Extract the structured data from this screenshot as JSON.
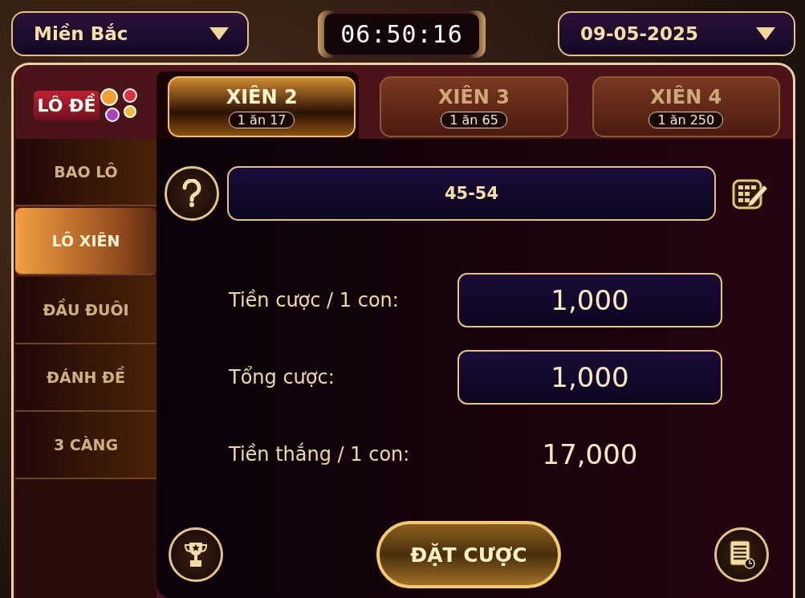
{
  "region": {
    "value": "Miền Bắc"
  },
  "clock": "06:50:16",
  "date": {
    "value": "09-05-2025"
  },
  "logo": "LÔ ĐỀ",
  "tabs": [
    {
      "label": "XIÊN 2",
      "odds": "1 ăn 17",
      "selected": true
    },
    {
      "label": "XIÊN 3",
      "odds": "1 ăn 65",
      "selected": false
    },
    {
      "label": "XIÊN 4",
      "odds": "1 ăn 250",
      "selected": false
    }
  ],
  "sidebar": {
    "items": [
      {
        "label": "BAO LÔ",
        "selected": false
      },
      {
        "label": "LÔ XIÊN",
        "selected": true
      },
      {
        "label": "ĐẦU ĐUÔI",
        "selected": false
      },
      {
        "label": "ĐÁNH ĐỀ",
        "selected": false
      },
      {
        "label": "3 CÀNG",
        "selected": false
      }
    ]
  },
  "numbers": {
    "value": "45-54"
  },
  "rows": [
    {
      "kind": "field",
      "label": "Tiền cược / 1 con:",
      "value": "1,000"
    },
    {
      "kind": "field",
      "label": "Tổng cược:",
      "value": "1,000"
    },
    {
      "kind": "text",
      "label": "Tiền thắng / 1 con:",
      "value": "17,000"
    }
  ],
  "submit": "ĐẶT CƯỢC"
}
